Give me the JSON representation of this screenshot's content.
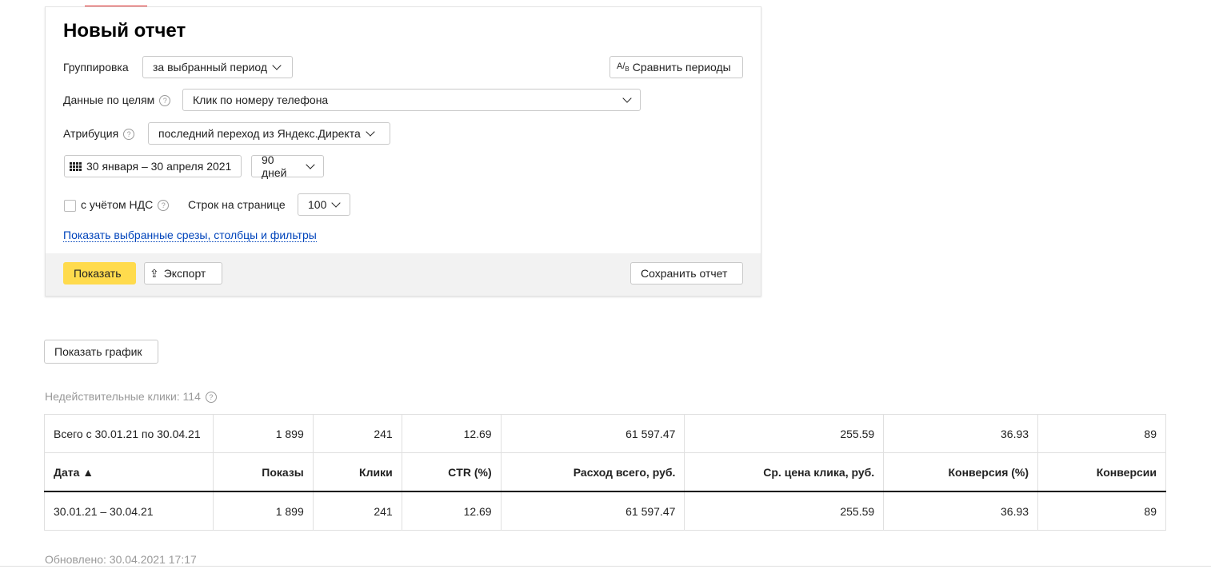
{
  "report": {
    "title": "Новый отчет",
    "grouping": {
      "label": "Группировка",
      "value": "за выбранный период"
    },
    "compare_label": "Сравнить периоды",
    "goals": {
      "label": "Данные по целям",
      "value": "Клик по номеру телефона"
    },
    "attribution": {
      "label": "Атрибуция",
      "value": "последний переход из Яндекс.Директа"
    },
    "date_range": "30 января – 30 апреля 2021",
    "period": "90 дней",
    "vat_label": "с учётом НДС",
    "rows_label": "Строк на странице",
    "rows_value": "100",
    "show_slices_link": "Показать выбранные срезы, столбцы и фильтры",
    "show_button": "Показать",
    "export_button": "Экспорт",
    "save_button": "Сохранить отчет"
  },
  "show_chart_button": "Показать график",
  "invalid_clicks": "Недействительные клики: 114",
  "table": {
    "total_row": [
      "Всего с 30.01.21 по 30.04.21",
      "1 899",
      "241",
      "12.69",
      "61 597.47",
      "255.59",
      "36.93",
      "89"
    ],
    "headers": [
      "Дата ▲",
      "Показы",
      "Клики",
      "CTR (%)",
      "Расход всего, руб.",
      "Ср. цена клика, руб.",
      "Конверсия (%)",
      "Конверсии"
    ],
    "rows": [
      [
        "30.01.21 – 30.04.21",
        "1 899",
        "241",
        "12.69",
        "61 597.47",
        "255.59",
        "36.93",
        "89"
      ]
    ]
  },
  "updated": "Обновлено: 30.04.2021 17:17",
  "colors": {
    "accent_yellow": "#ffdb4d",
    "tab_red": "#dd2222",
    "link_blue": "#0044bb"
  }
}
